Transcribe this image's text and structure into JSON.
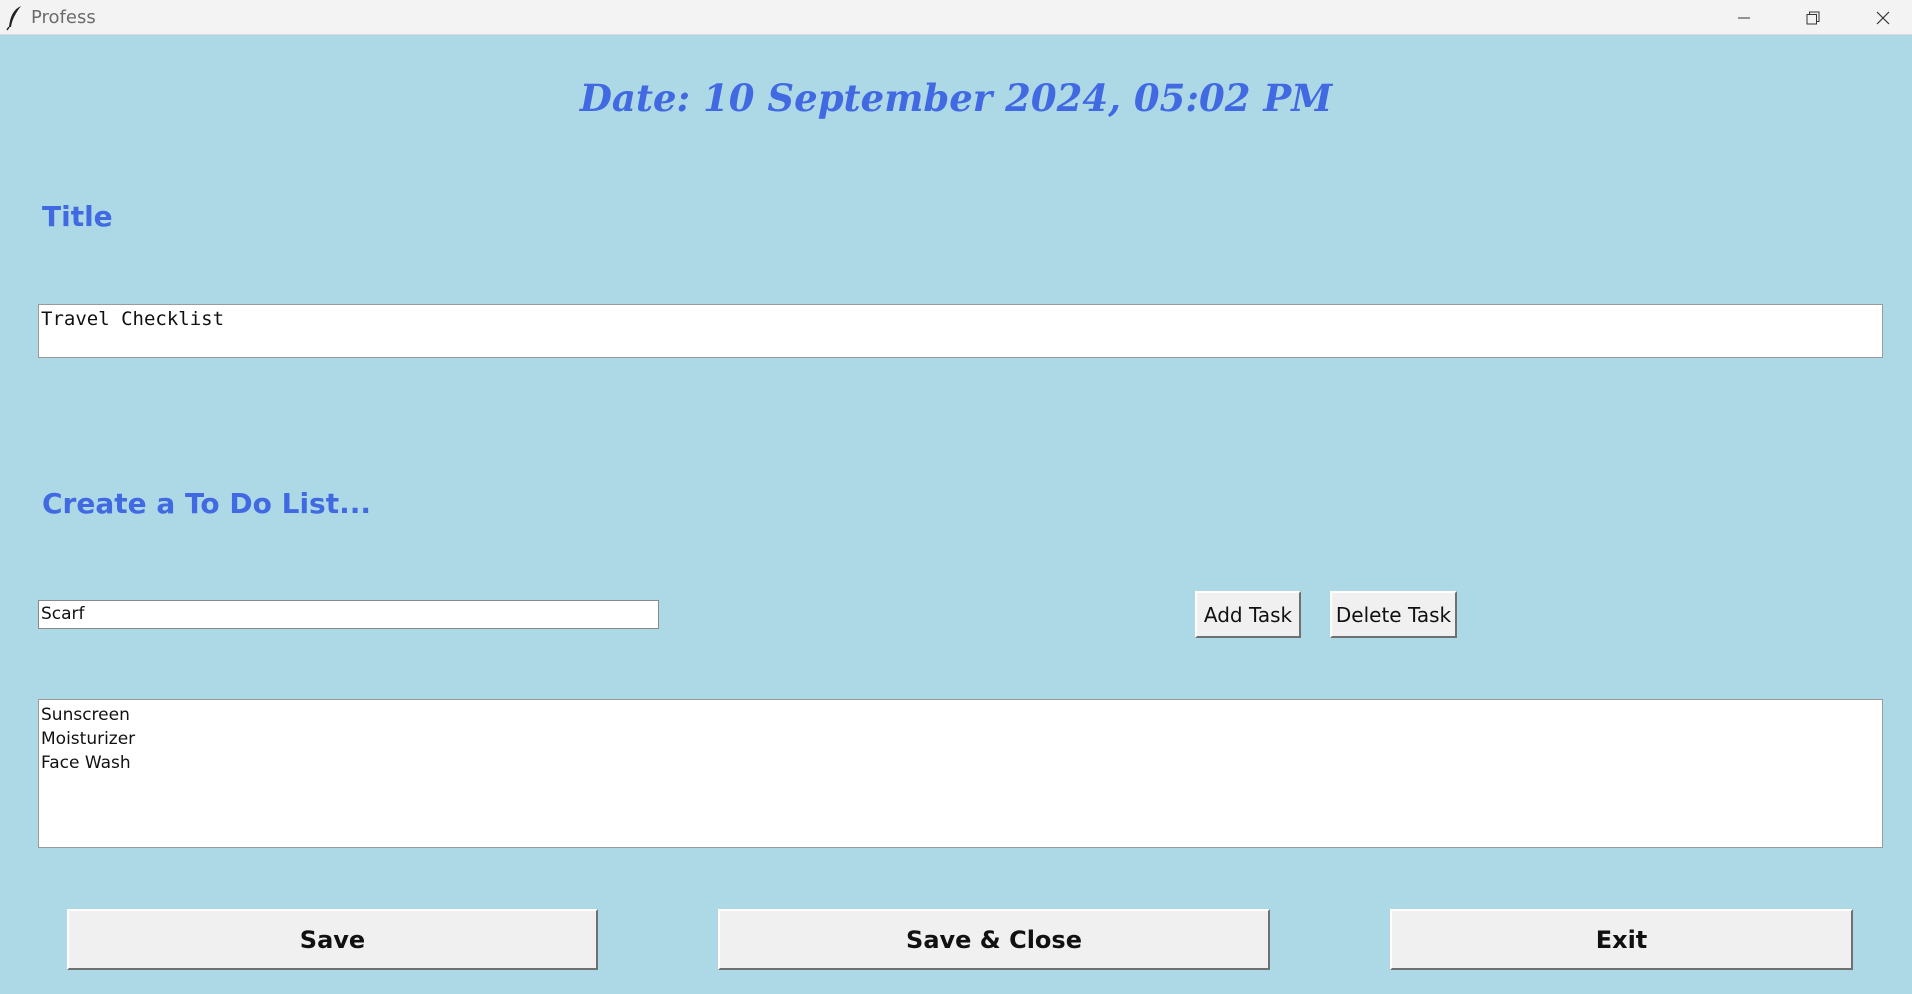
{
  "window": {
    "title": "Profess",
    "icon": "feather-icon",
    "controls": [
      "minimize-icon",
      "maximize-icon",
      "close-icon"
    ]
  },
  "date_label": "Date: 10 September 2024, 05:02 PM",
  "title_section": {
    "label": "Title",
    "value": "Travel Checklist"
  },
  "todo_section": {
    "label": "Create a To Do List...",
    "input_value": "Scarf",
    "add_button": "Add Task",
    "delete_button": "Delete Task",
    "tasks": [
      "Sunscreen",
      "Moisturizer",
      "Face Wash"
    ]
  },
  "actions": {
    "save": "Save",
    "save_close": "Save & Close",
    "exit": "Exit"
  },
  "colors": {
    "background": "#add8e6",
    "accent_text": "#4169e1",
    "button_face": "#f0f0f0"
  }
}
